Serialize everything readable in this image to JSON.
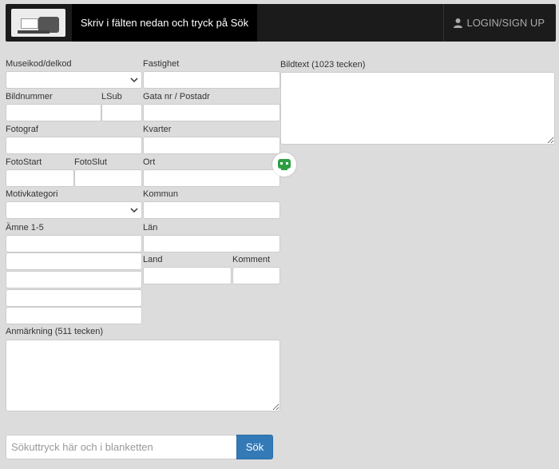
{
  "header": {
    "title": "Skriv i fälten nedan och tryck på Sök",
    "login_label": "LOGIN/SIGN UP",
    "user_icon": "user-icon"
  },
  "form": {
    "museikod_label": "Museikod/delkod",
    "fastighet_label": "Fastighet",
    "bildtext_label": "Bildtext (1023 tecken)",
    "bildnummer_label": "Bildnummer",
    "lsub_label": "LSub",
    "gata_label": "Gata nr / Postadr",
    "fotograf_label": "Fotograf",
    "kvarter_label": "Kvarter",
    "fotostart_label": "FotoStart",
    "fotoslut_label": "FotoSlut",
    "ort_label": "Ort",
    "motivkategori_label": "Motivkategori",
    "kommun_label": "Kommun",
    "amne_label": "Ämne 1-5",
    "lan_label": "Län",
    "land_label": "Land",
    "komment_label": "Komment",
    "anmarkning_label": "Anmärkning (511 tecken)"
  },
  "search": {
    "placeholder": "Sökuttryck här och i blanketten",
    "button_label": "Sök"
  },
  "colors": {
    "accent": "#337ab7",
    "bot_icon": "#2e9e44"
  }
}
